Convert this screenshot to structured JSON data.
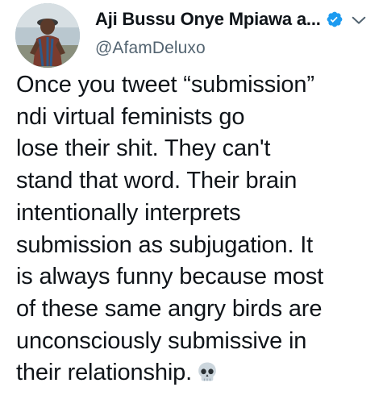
{
  "author": {
    "display_name": "Aji Bussu Onye Mpiawa a...",
    "handle": "@AfamDeluxo",
    "verified": true,
    "verified_color": "#1d9bf0"
  },
  "icons": {
    "avatar": "profile-photo",
    "verified": "verified-badge-icon",
    "more": "chevron-down-icon",
    "emoji": "skull-emoji-icon"
  },
  "tweet": {
    "lines": [
      "Once you tweet “submission”",
      "ndi virtual feminists go",
      "lose their shit.  They can't",
      "stand that word. Their brain",
      "intentionally interprets",
      "submission as subjugation. It",
      "is always funny because most",
      "of these same angry birds are",
      "unconsciously submissive in",
      "their relationship."
    ],
    "emoji": "💀"
  }
}
